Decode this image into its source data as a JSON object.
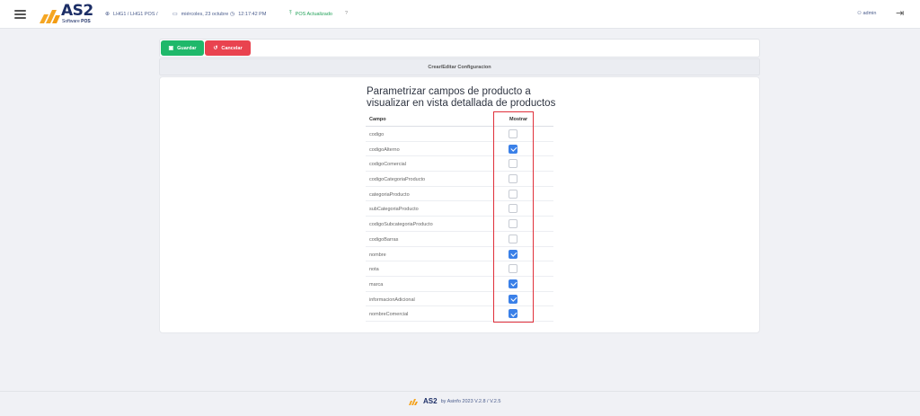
{
  "topbar": {
    "logo_text": "AS2",
    "logo_sub_prefix": "Software ",
    "logo_sub_bold": "POS",
    "location": "LHG1 / LHG1 POS /",
    "date": "miércoles, 23 octubre",
    "time": "12:17:42 PM",
    "pos_status": "POS Actualizado",
    "help": "?",
    "user": "admin"
  },
  "actions": {
    "save_label": "Guardar",
    "cancel_label": "Cancelar"
  },
  "section_title": "Crear/Editar Configuracion",
  "card": {
    "title": "Parametrizar campos de producto a visualizar en vista detallada de productos",
    "col_campo": "Campo",
    "col_mostrar": "Mostrar",
    "rows": [
      {
        "campo": "codigo",
        "mostrar": false
      },
      {
        "campo": "codigoAlterno",
        "mostrar": true
      },
      {
        "campo": "codigoComercial",
        "mostrar": false
      },
      {
        "campo": "codigoCategoriaProducto",
        "mostrar": false
      },
      {
        "campo": "categoriaProducto",
        "mostrar": false
      },
      {
        "campo": "subCategoriaProducto",
        "mostrar": false
      },
      {
        "campo": "codigoSubcategoriaProducto",
        "mostrar": false
      },
      {
        "campo": "codigoBarras",
        "mostrar": false
      },
      {
        "campo": "nombre",
        "mostrar": true
      },
      {
        "campo": "nota",
        "mostrar": false
      },
      {
        "campo": "marca",
        "mostrar": true
      },
      {
        "campo": "informacionAdicional",
        "mostrar": true
      },
      {
        "campo": "nombreComercial",
        "mostrar": true
      }
    ]
  },
  "footer": {
    "logo_text": "AS2",
    "credit": "by  Asinfo 2023  V.2.8 / V.2.5"
  },
  "colors": {
    "brand_navy": "#1c2e66",
    "brand_orange": "#f5a623",
    "save_green": "#1fb86a",
    "cancel_red": "#e9434f",
    "checkbox_blue": "#3a80e8",
    "highlight_red": "#e0303b"
  },
  "icons": {
    "menu": "hamburger-icon",
    "location": "globe-icon",
    "date": "calendar-icon",
    "time": "clock-icon",
    "status": "upload-icon",
    "user": "user-icon",
    "logout": "logout-icon",
    "save": "save-icon",
    "cancel": "undo-icon"
  }
}
